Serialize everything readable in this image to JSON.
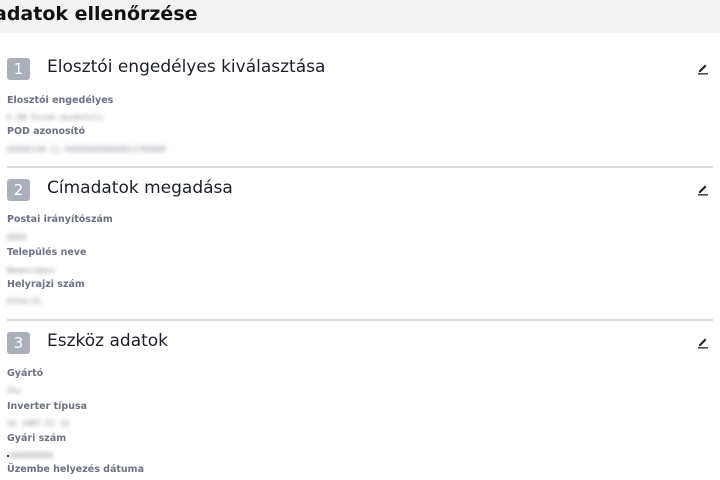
{
  "page": {
    "title": "adatok ellenőrzése"
  },
  "sections": [
    {
      "number": "1",
      "title": "Elosztói engedélyes kiválasztása",
      "fields": [
        {
          "label": "Elosztói engedélyes",
          "value": "E.ON Észak-dunántúli"
        },
        {
          "label": "POD azonosító",
          "value": "HU000130-11-S00000000000012700000"
        }
      ]
    },
    {
      "number": "2",
      "title": "Címadatok megadása",
      "fields": [
        {
          "label": "Postai irányítószám",
          "value": "0000"
        },
        {
          "label": "Település neve",
          "value": "Nemesvámos"
        },
        {
          "label": "Helyrajzi szám",
          "value": "0154/25"
        }
      ]
    },
    {
      "number": "3",
      "title": "Eszköz adatok",
      "fields": [
        {
          "label": "Gyártó",
          "value": "Sku"
        },
        {
          "label": "Inverter típusa",
          "value": "SG 10RT-P2 15"
        },
        {
          "label": "Gyári szám",
          "value": "A00000000"
        },
        {
          "label": "Üzembe helyezés dátuma",
          "value": ""
        }
      ]
    }
  ],
  "icons": {
    "edit": "pencil-edit-icon"
  },
  "colors": {
    "step_badge": "#aab0bb",
    "label": "#6b7280",
    "divider": "#d9dadd"
  }
}
